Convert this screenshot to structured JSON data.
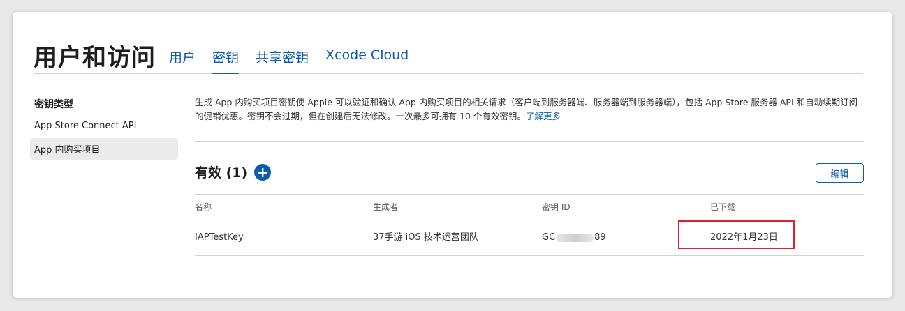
{
  "header": {
    "title": "用户和访问",
    "tabs": [
      {
        "label": "用户",
        "active": false
      },
      {
        "label": "密钥",
        "active": true
      },
      {
        "label": "共享密钥",
        "active": false
      },
      {
        "label": "Xcode Cloud",
        "active": false
      }
    ]
  },
  "sidebar": {
    "heading": "密钥类型",
    "items": [
      {
        "label": "App Store Connect API",
        "selected": false
      },
      {
        "label": "App 内购买项目",
        "selected": true
      }
    ]
  },
  "description": {
    "text": "生成 App 内购买项目密钥使 Apple 可以验证和确认 App 内购买项目的相关请求（客户端到服务器端、服务器端到服务器端），包括 App Store 服务器 API 和自动续期订阅的促销优惠。密钥不会过期，但在创建后无法修改。一次最多可拥有 10 个有效密钥。",
    "link": "了解更多"
  },
  "section": {
    "title": "有效 (1)",
    "add_icon": "+",
    "edit_label": "编辑"
  },
  "table": {
    "columns": [
      "名称",
      "生成者",
      "密钥 ID",
      "已下载"
    ],
    "rows": [
      {
        "name": "IAPTestKey",
        "creator": "37手游 iOS 技术运营团队",
        "key_id_prefix": "GC",
        "key_id_suffix": "89",
        "downloaded": "2022年1月23日"
      }
    ]
  },
  "colors": {
    "accent": "#0b5cad",
    "highlight": "#e0202a"
  }
}
